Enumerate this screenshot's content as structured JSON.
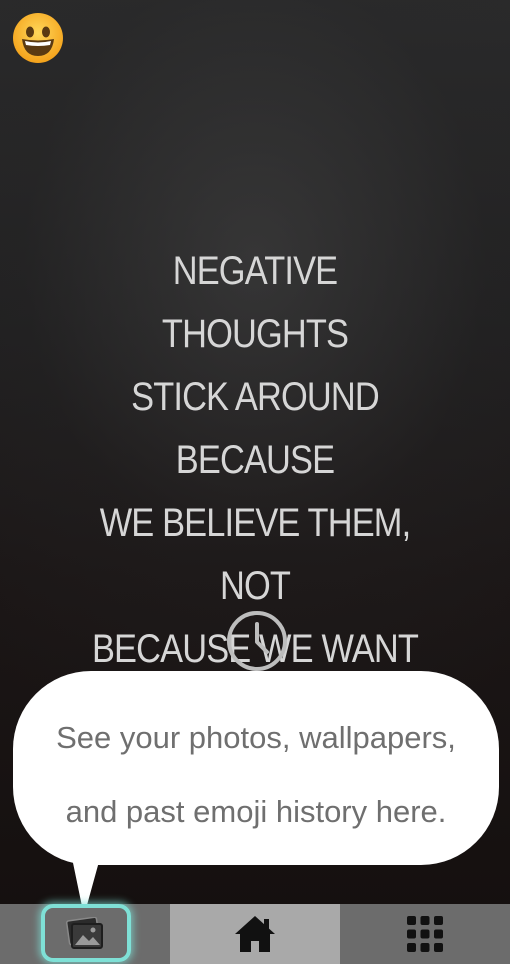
{
  "quote": {
    "text": "NEGATIVE THOUGHTS\nSTICK AROUND BECAUSE\nWE BELIEVE THEM, NOT\nBECAUSE WE WANT OR\nCHOOSE THEM."
  },
  "tooltip": {
    "line1": "See your photos, wallpapers,",
    "line2": "and past emoji history here."
  },
  "tabbar": {
    "tabs": [
      {
        "name": "gallery",
        "icon": "photos-icon",
        "selected": false,
        "highlighted": true
      },
      {
        "name": "home",
        "icon": "home-icon",
        "selected": true
      },
      {
        "name": "apps",
        "icon": "grid-icon",
        "selected": false
      }
    ]
  },
  "top": {
    "emoji_icon": "grinning-face-icon"
  },
  "colors": {
    "highlight": "#7fe0d6",
    "tab_bg": "#6c6c6c",
    "tab_selected_bg": "#a9a9a9",
    "quote_text": "#d6d6d6",
    "tooltip_text": "#6f6f6f"
  }
}
